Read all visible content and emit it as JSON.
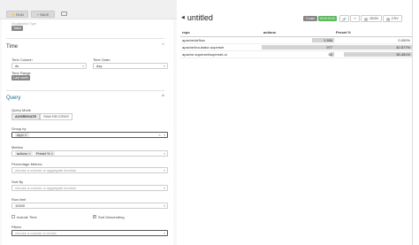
{
  "topbar": {
    "run_label": "RUN",
    "save_label": "SAVE"
  },
  "datasource": {
    "faded_label": "Visualization Type",
    "viz_type": "Table"
  },
  "time": {
    "title": "Time",
    "time_column_label": "Time Column",
    "time_column_value": "ds",
    "time_grain_label": "Time Grain",
    "time_grain_value": "day",
    "time_range_label": "Time Range",
    "time_range_value": "Last week"
  },
  "query": {
    "title": "Query",
    "mode_label": "Query Mode",
    "tabs": [
      "AGGREGATE",
      "RAW RECORDS"
    ],
    "group_by_label": "Group by",
    "group_by_chip": "repo",
    "metrics_label": "Metrics",
    "metrics_chips": [
      "actions",
      "Preset %"
    ],
    "pct_metrics_label": "Percentage Metrics",
    "pct_metrics_placeholder": "choose a column or aggregate function",
    "sort_by_label": "Sort By",
    "sort_by_placeholder": "choose a column or aggregate function",
    "row_limit_label": "Row limit",
    "row_limit_value": "10000",
    "include_time_label": "Include Time",
    "sort_desc_label": "Sort Descending",
    "filters_label": "Filters",
    "filters_placeholder": "choose a column or metric"
  },
  "slice": {
    "title": "untitled",
    "badge_rows": "3 rows",
    "badge_time": "00:00:00.53",
    "json_label": ".JSON",
    "csv_label": ".CSV"
  },
  "table": {
    "columns": [
      "repo",
      "actions",
      "Preset %"
    ],
    "rows": [
      {
        "repo": "apache/airflow",
        "actions": "1.50k",
        "actions_frac": 0.3,
        "preset": "0.000%",
        "preset_frac": 0.0
      },
      {
        "repo": "apache/incubator-superset",
        "actions": "977",
        "actions_frac": 1.0,
        "preset": "40.577%",
        "preset_frac": 1.0
      },
      {
        "repo": "apache-superset/superset-ui",
        "actions": "54",
        "actions_frac": 0.06,
        "preset": "35.451%",
        "preset_frac": 0.87
      }
    ]
  },
  "colors": {
    "badge_green": "#5cb85c",
    "badge_gray": "#888888",
    "accent_query": "#1a6b8d"
  }
}
